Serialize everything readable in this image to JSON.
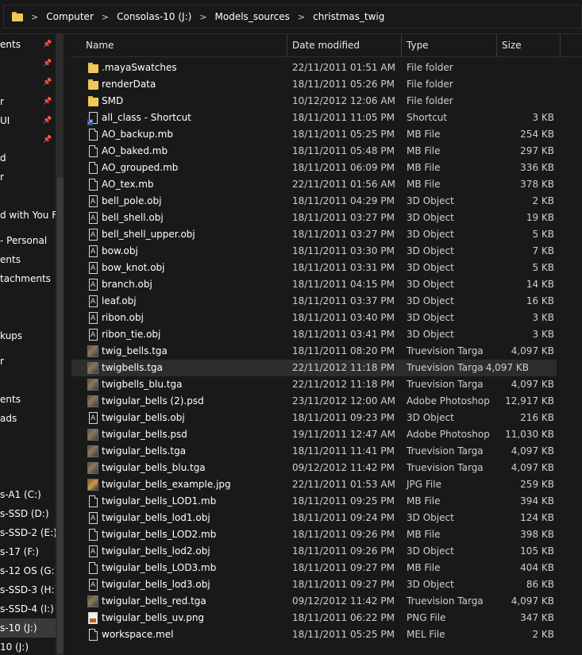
{
  "breadcrumb": [
    "Computer",
    "Consolas-10 (J:)",
    "Models_sources",
    "christmas_twig"
  ],
  "nav": {
    "items": [
      {
        "label": "ents",
        "pinned": true
      },
      {
        "label": "",
        "pinned": true
      },
      {
        "label": "",
        "pinned": true
      },
      {
        "label": "r",
        "pinned": true
      },
      {
        "label": "UI",
        "pinned": true
      },
      {
        "label": "",
        "pinned": true
      },
      {
        "label": "d",
        "pinned": false
      },
      {
        "label": "r",
        "pinned": false
      },
      {
        "label": "",
        "pinned": false
      },
      {
        "label": "d with You Ful",
        "pinned": false
      },
      {
        "label": "- Personal",
        "pinned": false
      },
      {
        "label": "ents",
        "pinned": false
      },
      {
        "label": "tachments",
        "pinned": false
      },
      {
        "label": "",
        "pinned": false
      },
      {
        "label": "",
        "pinned": false
      },
      {
        "label": "kups",
        "pinned": false
      },
      {
        "label": "r",
        "pinned": false
      },
      {
        "label": "",
        "pinned": false
      },
      {
        "label": "ents",
        "pinned": false
      },
      {
        "label": "ads",
        "pinned": false
      },
      {
        "label": "",
        "pinned": false
      },
      {
        "label": "",
        "pinned": false
      },
      {
        "label": "s-A1 (C:)",
        "pinned": false
      },
      {
        "label": "s-SSD (D:)",
        "pinned": false
      },
      {
        "label": "s-SSD-2 (E:)",
        "pinned": false
      },
      {
        "label": "s-17 (F:)",
        "pinned": false
      },
      {
        "label": "s-12 OS (G:)",
        "pinned": false
      },
      {
        "label": "s-SSD-3 (H:)",
        "pinned": false
      },
      {
        "label": "s-SSD-4 (I:)",
        "pinned": false
      },
      {
        "label": "s-10 (J:)",
        "pinned": false
      },
      {
        "label": "10 (J:)",
        "pinned": false
      }
    ]
  },
  "columns": {
    "name": "Name",
    "date": "Date modified",
    "type": "Type",
    "size": "Size"
  },
  "files": [
    {
      "name": ".mayaSwatches",
      "date": "22/11/2011 01:51 AM",
      "type": "File folder",
      "size": "",
      "icon": "folder-icon"
    },
    {
      "name": "renderData",
      "date": "18/11/2011 05:26 PM",
      "type": "File folder",
      "size": "",
      "icon": "folder-icon"
    },
    {
      "name": "SMD",
      "date": "10/12/2012 12:06 AM",
      "type": "File folder",
      "size": "",
      "icon": "folder-icon"
    },
    {
      "name": "all_class - Shortcut",
      "date": "18/11/2011 11:05 PM",
      "type": "Shortcut",
      "size": "3 KB",
      "icon": "shortcut-icon"
    },
    {
      "name": "AO_backup.mb",
      "date": "18/11/2011 05:25 PM",
      "type": "MB File",
      "size": "254 KB",
      "icon": "document-icon"
    },
    {
      "name": "AO_baked.mb",
      "date": "18/11/2011 05:48 PM",
      "type": "MB File",
      "size": "297 KB",
      "icon": "document-icon"
    },
    {
      "name": "AO_grouped.mb",
      "date": "18/11/2011 06:09 PM",
      "type": "MB File",
      "size": "336 KB",
      "icon": "document-icon"
    },
    {
      "name": "AO_tex.mb",
      "date": "22/11/2011 01:56 AM",
      "type": "MB File",
      "size": "378 KB",
      "icon": "document-icon"
    },
    {
      "name": "bell_pole.obj",
      "date": "18/11/2011 04:29 PM",
      "type": "3D Object",
      "size": "2 KB",
      "icon": "3d-object-icon"
    },
    {
      "name": "bell_shell.obj",
      "date": "18/11/2011 03:27 PM",
      "type": "3D Object",
      "size": "19 KB",
      "icon": "3d-object-icon"
    },
    {
      "name": "bell_shell_upper.obj",
      "date": "18/11/2011 03:27 PM",
      "type": "3D Object",
      "size": "5 KB",
      "icon": "3d-object-icon"
    },
    {
      "name": "bow.obj",
      "date": "18/11/2011 03:30 PM",
      "type": "3D Object",
      "size": "7 KB",
      "icon": "3d-object-icon"
    },
    {
      "name": "bow_knot.obj",
      "date": "18/11/2011 03:31 PM",
      "type": "3D Object",
      "size": "5 KB",
      "icon": "3d-object-icon"
    },
    {
      "name": "branch.obj",
      "date": "18/11/2011 04:15 PM",
      "type": "3D Object",
      "size": "14 KB",
      "icon": "3d-object-icon"
    },
    {
      "name": "leaf.obj",
      "date": "18/11/2011 03:37 PM",
      "type": "3D Object",
      "size": "16 KB",
      "icon": "3d-object-icon"
    },
    {
      "name": "ribon.obj",
      "date": "18/11/2011 03:40 PM",
      "type": "3D Object",
      "size": "3 KB",
      "icon": "3d-object-icon"
    },
    {
      "name": "ribon_tie.obj",
      "date": "18/11/2011 03:41 PM",
      "type": "3D Object",
      "size": "3 KB",
      "icon": "3d-object-icon"
    },
    {
      "name": "twig_bells.tga",
      "date": "18/11/2011 08:20 PM",
      "type": "Truevision Targa",
      "size": "4,097 KB",
      "icon": "image-thumbnail-icon"
    },
    {
      "name": "twigbells.tga",
      "date": "22/11/2012 11:18 PM",
      "type": "Truevision Targa",
      "size": "4,097 KB",
      "icon": "image-thumbnail-icon",
      "hover": true
    },
    {
      "name": "twigbells_blu.tga",
      "date": "22/11/2012 11:18 PM",
      "type": "Truevision Targa",
      "size": "4,097 KB",
      "icon": "image-thumbnail-icon"
    },
    {
      "name": "twigular_bells (2).psd",
      "date": "23/11/2012 12:00 AM",
      "type": "Adobe Photoshop",
      "size": "12,917 KB",
      "icon": "image-thumbnail-icon"
    },
    {
      "name": "twigular_bells.obj",
      "date": "18/11/2011 09:23 PM",
      "type": "3D Object",
      "size": "216 KB",
      "icon": "3d-object-icon"
    },
    {
      "name": "twigular_bells.psd",
      "date": "19/11/2011 12:47 AM",
      "type": "Adobe Photoshop",
      "size": "11,030 KB",
      "icon": "image-thumbnail-icon"
    },
    {
      "name": "twigular_bells.tga",
      "date": "18/11/2011 11:41 PM",
      "type": "Truevision Targa",
      "size": "4,097 KB",
      "icon": "image-thumbnail-icon"
    },
    {
      "name": "twigular_bells_blu.tga",
      "date": "09/12/2012 11:42 PM",
      "type": "Truevision Targa",
      "size": "4,097 KB",
      "icon": "image-thumbnail-icon"
    },
    {
      "name": "twigular_bells_example.jpg",
      "date": "22/11/2011 01:53 AM",
      "type": "JPG File",
      "size": "259 KB",
      "icon": "jpg-thumbnail-icon"
    },
    {
      "name": "twigular_bells_LOD1.mb",
      "date": "18/11/2011 09:25 PM",
      "type": "MB File",
      "size": "394 KB",
      "icon": "document-icon"
    },
    {
      "name": "twigular_bells_lod1.obj",
      "date": "18/11/2011 09:24 PM",
      "type": "3D Object",
      "size": "124 KB",
      "icon": "3d-object-icon"
    },
    {
      "name": "twigular_bells_LOD2.mb",
      "date": "18/11/2011 09:26 PM",
      "type": "MB File",
      "size": "398 KB",
      "icon": "document-icon"
    },
    {
      "name": "twigular_bells_lod2.obj",
      "date": "18/11/2011 09:26 PM",
      "type": "3D Object",
      "size": "105 KB",
      "icon": "3d-object-icon"
    },
    {
      "name": "twigular_bells_LOD3.mb",
      "date": "18/11/2011 09:27 PM",
      "type": "MB File",
      "size": "404 KB",
      "icon": "document-icon"
    },
    {
      "name": "twigular_bells_lod3.obj",
      "date": "18/11/2011 09:27 PM",
      "type": "3D Object",
      "size": "86 KB",
      "icon": "3d-object-icon"
    },
    {
      "name": "twigular_bells_red.tga",
      "date": "09/12/2012 11:42 PM",
      "type": "Truevision Targa",
      "size": "4,097 KB",
      "icon": "image-thumbnail-icon"
    },
    {
      "name": "twigular_bells_uv.png",
      "date": "18/11/2011 06:22 PM",
      "type": "PNG File",
      "size": "347 KB",
      "icon": "png-icon"
    },
    {
      "name": "workspace.mel",
      "date": "18/11/2011 05:25 PM",
      "type": "MEL File",
      "size": "2 KB",
      "icon": "document-icon"
    }
  ],
  "colors": {
    "background": "#191919",
    "hover_row": "#2d2d2d",
    "selected_nav": "#3a3a3a",
    "folder": "#f0c85a"
  }
}
